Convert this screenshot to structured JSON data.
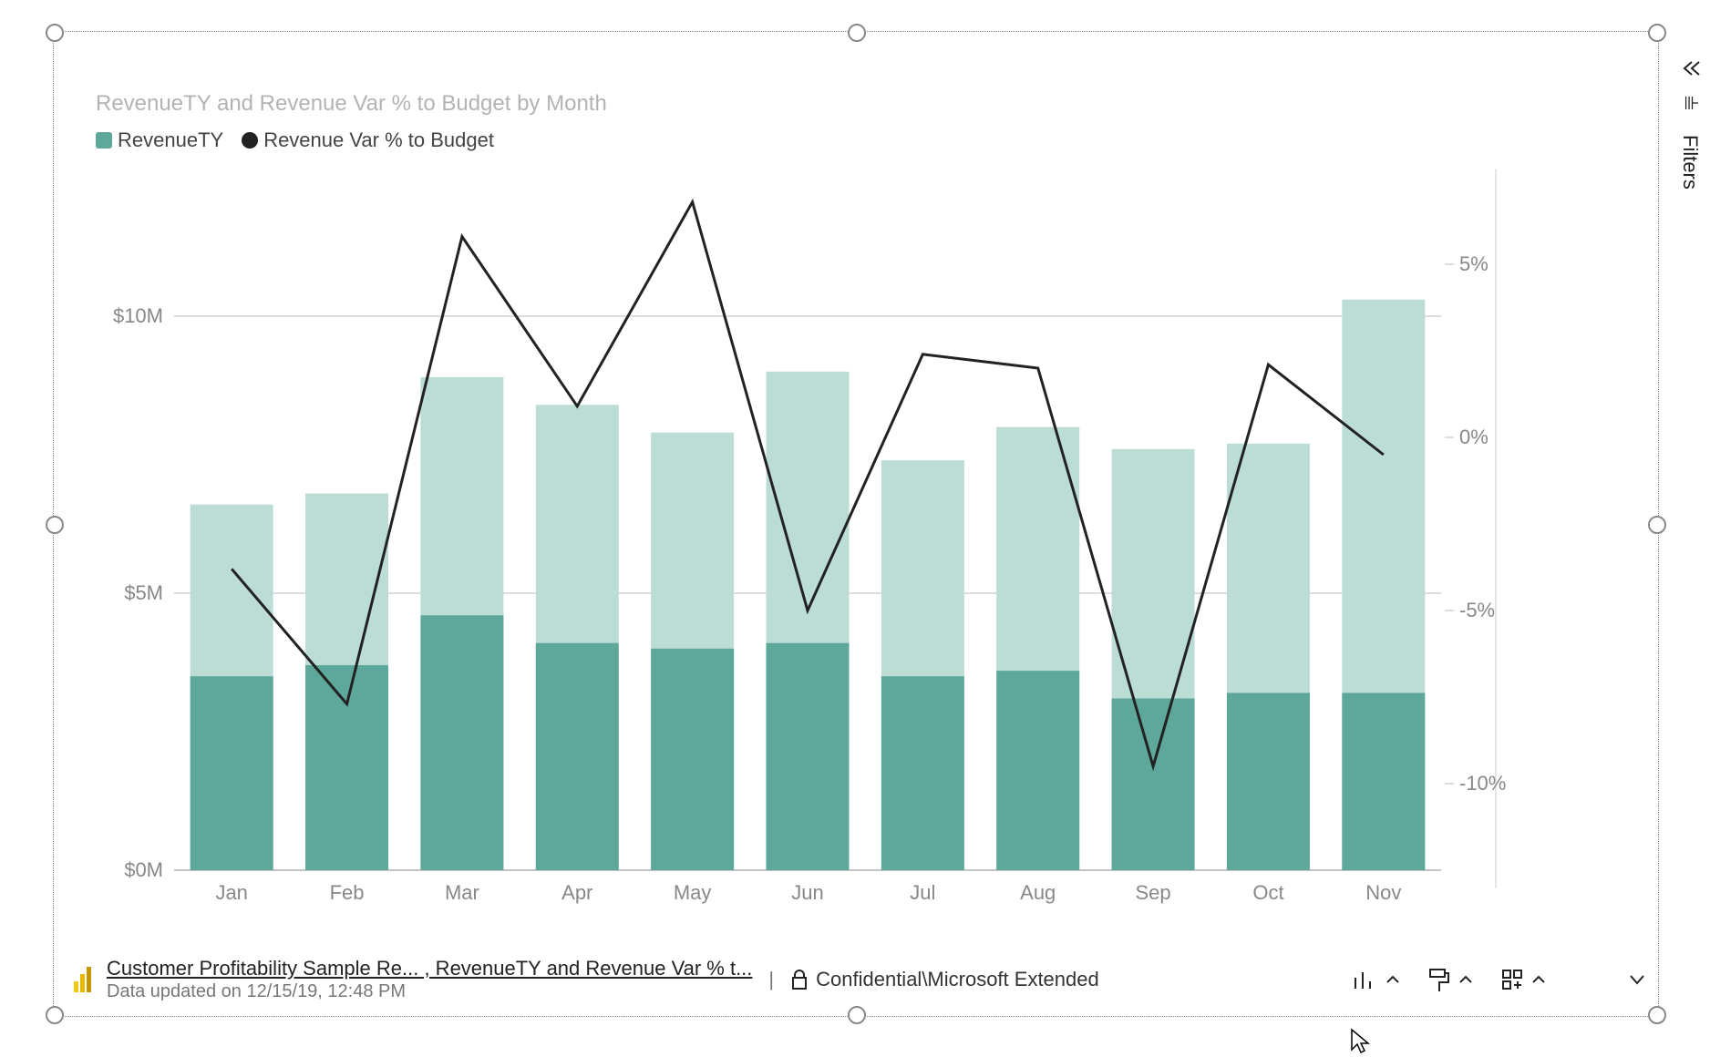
{
  "title": "RevenueTY and Revenue Var % to Budget by Month",
  "legend": {
    "series1_label": "RevenueTY",
    "series1_color": "#5da79b",
    "series2_label": "Revenue Var % to Budget",
    "series2_color": "#222222"
  },
  "footer": {
    "link_text": "Customer Profitability Sample Re... , RevenueTY and Revenue Var % t...",
    "updated_text": "Data updated on 12/15/19, 12:48 PM",
    "sensitivity_label": "Confidential\\Microsoft Extended"
  },
  "side_panel": {
    "filters_label": "Filters"
  },
  "chart_data": {
    "type": "bar+line",
    "categories": [
      "Jan",
      "Feb",
      "Mar",
      "Apr",
      "May",
      "Jun",
      "Jul",
      "Aug",
      "Sep",
      "Oct",
      "Nov"
    ],
    "series": [
      {
        "name": "RevenueTY_light",
        "axis": "left",
        "values": [
          6.6,
          6.8,
          8.9,
          8.4,
          7.9,
          9.0,
          7.4,
          8.0,
          7.6,
          7.7,
          10.3
        ]
      },
      {
        "name": "RevenueTY_dark",
        "axis": "left",
        "values": [
          3.5,
          3.7,
          4.6,
          4.1,
          4.0,
          4.1,
          3.5,
          3.6,
          3.1,
          3.2,
          3.2
        ]
      },
      {
        "name": "Revenue Var % to Budget",
        "axis": "right",
        "type": "line",
        "values": [
          -3.8,
          -7.7,
          5.8,
          0.9,
          6.8,
          -5.0,
          2.4,
          2.0,
          -9.5,
          2.1,
          -0.5
        ]
      }
    ],
    "left_axis": {
      "label": "",
      "ticks": [
        0,
        5,
        10
      ],
      "tick_labels": [
        "$0M",
        "$5M",
        "$10M"
      ],
      "range": [
        0,
        12.5
      ]
    },
    "right_axis": {
      "label": "",
      "ticks": [
        -10,
        -5,
        0,
        5
      ],
      "tick_labels": [
        "-10%",
        "-5%",
        "0%",
        "5%"
      ],
      "range": [
        -12.5,
        7.5
      ]
    },
    "xlabel": "",
    "ylabel": "",
    "title": "RevenueTY and Revenue Var % to Budget by Month"
  }
}
